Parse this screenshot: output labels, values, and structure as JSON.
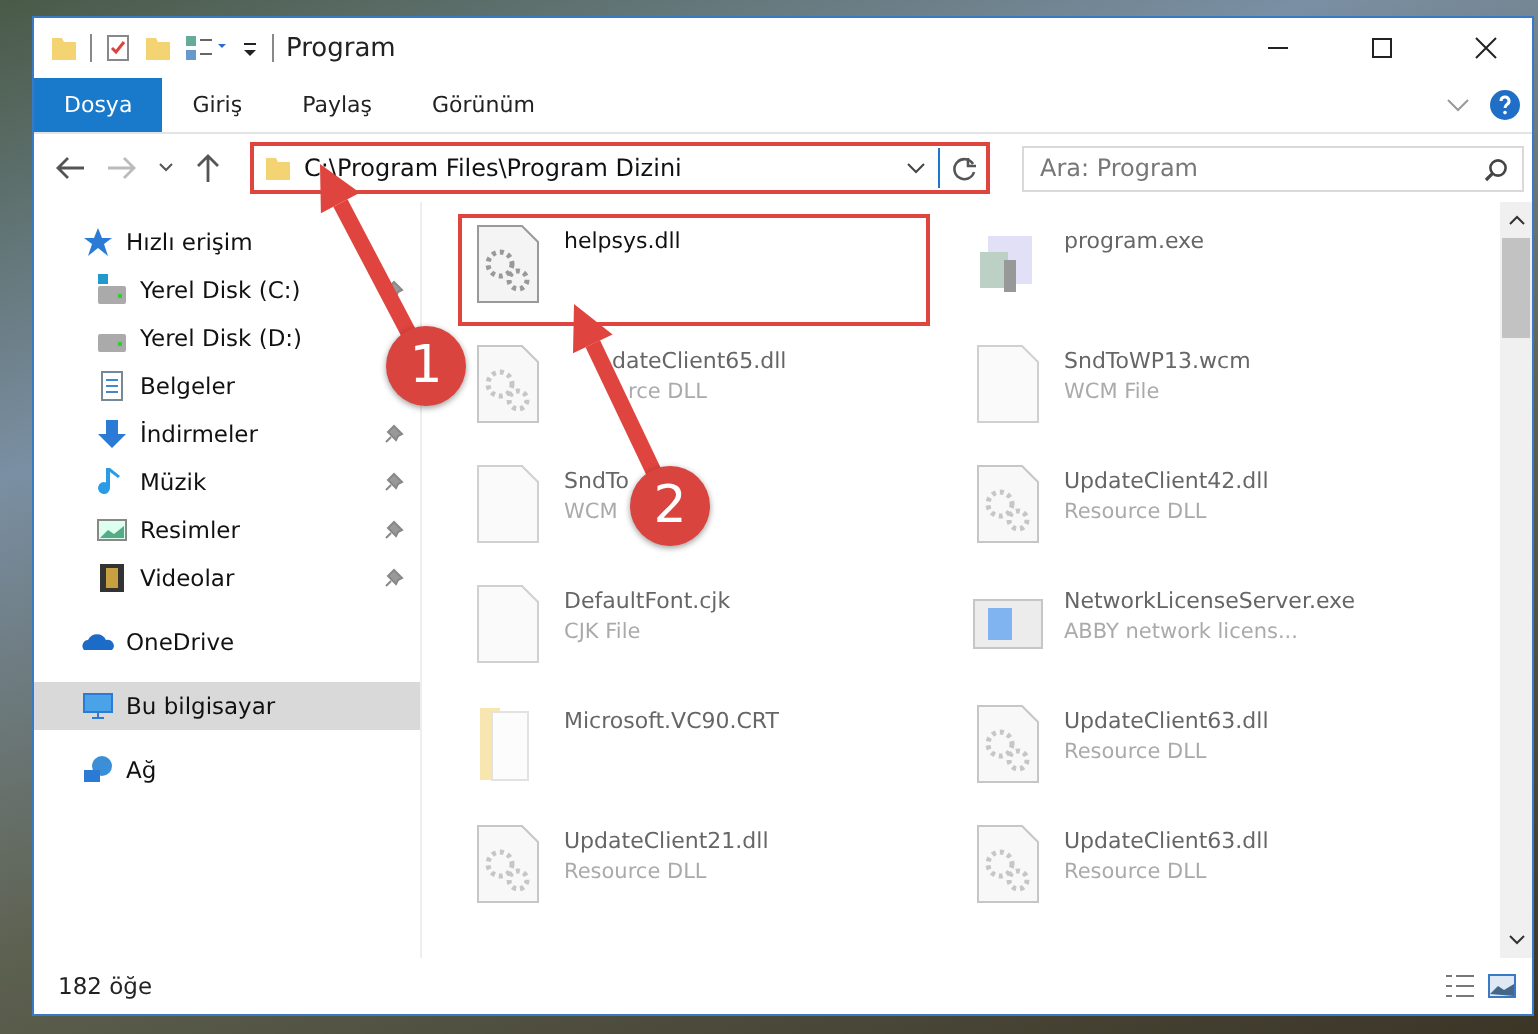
{
  "window": {
    "title": "Program"
  },
  "ribbon_tabs": [
    {
      "label": "Dosya",
      "selected": true
    },
    {
      "label": "Giriş",
      "selected": false
    },
    {
      "label": "Paylaş",
      "selected": false
    },
    {
      "label": "Görünüm",
      "selected": false
    }
  ],
  "address_bar": {
    "path": "C:\\Program Files\\Program Dizini",
    "highlighted": true
  },
  "search": {
    "placeholder": "Ara: Program"
  },
  "sidebar": {
    "items": [
      {
        "label": "Hızlı erişim",
        "kind": "star",
        "selected": false,
        "children": [
          {
            "label": "Yerel Disk (C:)",
            "kind": "drive-c",
            "pinned": true,
            "selected": false
          },
          {
            "label": "Yerel Disk (D:)",
            "kind": "drive",
            "pinned": false,
            "selected": false
          },
          {
            "label": "Belgeler",
            "kind": "docs",
            "pinned": false,
            "selected": false
          },
          {
            "label": "İndirmeler",
            "kind": "download",
            "pinned": true,
            "selected": false
          },
          {
            "label": "Müzik",
            "kind": "music",
            "pinned": true,
            "selected": false
          },
          {
            "label": "Resimler",
            "kind": "pictures",
            "pinned": true,
            "selected": false
          },
          {
            "label": "Videolar",
            "kind": "video",
            "pinned": true,
            "selected": false
          }
        ]
      },
      {
        "label": "OneDrive",
        "kind": "cloud",
        "selected": false
      },
      {
        "label": "Bu bilgisayar",
        "kind": "pc",
        "selected": true
      },
      {
        "label": "Ağ",
        "kind": "network",
        "selected": false
      }
    ]
  },
  "files": [
    {
      "name": "helpsys.dll",
      "kind": "gear",
      "blurred": false,
      "highlighted": true
    },
    {
      "name": "program.exe",
      "kind": "exe",
      "blurred": true,
      "highlighted": false
    },
    {
      "name": "dateClient65.dll",
      "type": "rce DLL",
      "kind": "gear",
      "blurred": true,
      "highlighted": false,
      "partly_covered": true
    },
    {
      "name": "SndToWP13.wcm",
      "type": "WCM File",
      "kind": "blank",
      "blurred": true,
      "highlighted": false
    },
    {
      "name": "SndTo",
      "type": "WCM",
      "kind": "blank",
      "blurred": true,
      "highlighted": false
    },
    {
      "name": "UpdateClient42.dll",
      "type": "Resource DLL",
      "kind": "gear",
      "blurred": true,
      "highlighted": false
    },
    {
      "name": "DefaultFont.cjk",
      "type": "CJK File",
      "kind": "blank",
      "blurred": true,
      "highlighted": false
    },
    {
      "name": "NetworkLicenseServer.exe",
      "type": "ABBY network licens...",
      "kind": "app",
      "blurred": true,
      "highlighted": false
    },
    {
      "name": "Microsoft.VC90.CRT",
      "kind": "folder",
      "blurred": true,
      "highlighted": false
    },
    {
      "name": "UpdateClient63.dll",
      "type": "Resource DLL",
      "kind": "gear",
      "blurred": true,
      "highlighted": false
    },
    {
      "name": "UpdateClient21.dll",
      "type": "Resource DLL",
      "kind": "gear",
      "blurred": true,
      "highlighted": false
    },
    {
      "name": "UpdateClient63.dll",
      "type": "Resource DLL",
      "kind": "gear",
      "blurred": true,
      "highlighted": false
    }
  ],
  "status_bar": {
    "count": "182 öğe"
  },
  "annotations": [
    {
      "number": "1"
    },
    {
      "number": "2"
    }
  ]
}
